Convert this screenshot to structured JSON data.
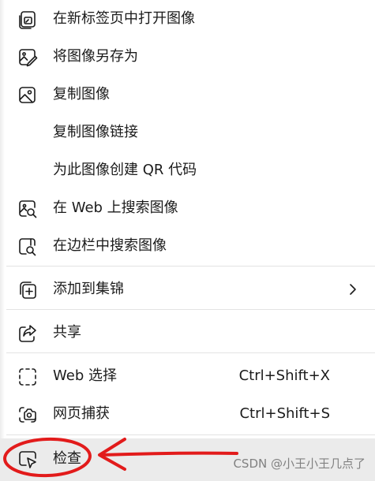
{
  "menu": {
    "items": {
      "open_new_tab": {
        "label": "在新标签页中打开图像",
        "icon": "open-in-new-tab-icon"
      },
      "save_as": {
        "label": "将图像另存为",
        "icon": "save-image-icon"
      },
      "copy_image": {
        "label": "复制图像",
        "icon": "image-icon"
      },
      "copy_link": {
        "label": "复制图像链接"
      },
      "create_qr": {
        "label": "为此图像创建 QR 代码"
      },
      "search_web": {
        "label": "在 Web 上搜索图像",
        "icon": "image-search-icon"
      },
      "search_sidebar": {
        "label": "在边栏中搜索图像",
        "icon": "sidebar-search-icon"
      },
      "add_collection": {
        "label": "添加到集锦",
        "icon": "add-to-collection-icon",
        "submenu_icon": "chevron-right-icon"
      },
      "share": {
        "label": "共享",
        "icon": "share-icon"
      },
      "web_select": {
        "label": "Web 选择",
        "shortcut": "Ctrl+Shift+X",
        "icon": "web-select-icon"
      },
      "web_capture": {
        "label": "网页捕获",
        "shortcut": "Ctrl+Shift+S",
        "icon": "web-capture-icon"
      },
      "inspect": {
        "label": "检查",
        "icon": "inspect-icon"
      }
    }
  },
  "annotation": {
    "color": "#e21b1b"
  },
  "watermark": "CSDN @小王小王几点了"
}
